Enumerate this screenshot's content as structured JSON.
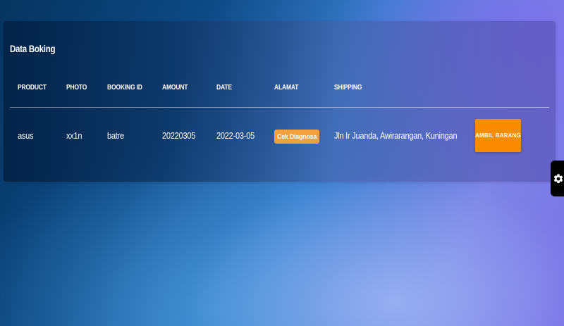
{
  "card": {
    "title": "Data Boking"
  },
  "table": {
    "headers": {
      "product": "PRODUCT",
      "photo": "PHOTO",
      "booking_id": "BOOKING ID",
      "amount": "AMOUNT",
      "date": "DATE",
      "alamat": "ALAMAT",
      "shipping": "SHIPPING"
    },
    "rows": [
      {
        "product": "asus",
        "photo": "xx1n",
        "booking_id": "batre",
        "amount": "20220305",
        "date": "2022-03-05",
        "alamat_badge": "Cek Diagnosa",
        "shipping": "Jln Ir Juanda, Awirarangan, Kuningan",
        "action_label": "AMBIL BARANG"
      }
    ]
  },
  "colors": {
    "badge": "#f2a13d",
    "action_button": "#fb8c00",
    "settings_tab": "#000000"
  },
  "icons": {
    "settings": "gear-icon"
  }
}
